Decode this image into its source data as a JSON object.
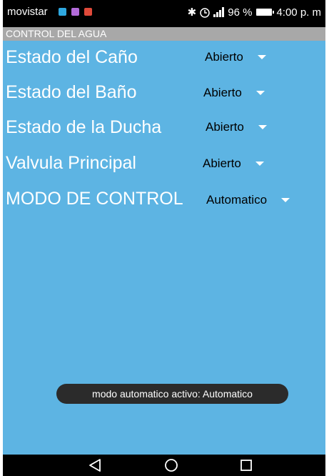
{
  "status_bar": {
    "carrier": "movistar",
    "battery": "96 %",
    "time": "4:00 p. m",
    "notification_colors": [
      "#2ea8e0",
      "#b36bd9",
      "#e04a3a"
    ]
  },
  "app": {
    "title": "CONTROL DEL AGUA",
    "background": "#5db4e3"
  },
  "controls": [
    {
      "label": "Estado del Caño",
      "value": "Abierto"
    },
    {
      "label": "Estado del Baño",
      "value": "Abierto"
    },
    {
      "label": "Estado de la Ducha",
      "value": "Abierto"
    },
    {
      "label": "Valvula Principal",
      "value": "Abierto"
    },
    {
      "label": "MODO DE CONTROL",
      "value": "Automatico"
    }
  ],
  "toast": {
    "text": "modo automatico activo: Automatico"
  },
  "nav_icons": [
    "back-icon",
    "home-icon",
    "recents-icon"
  ]
}
